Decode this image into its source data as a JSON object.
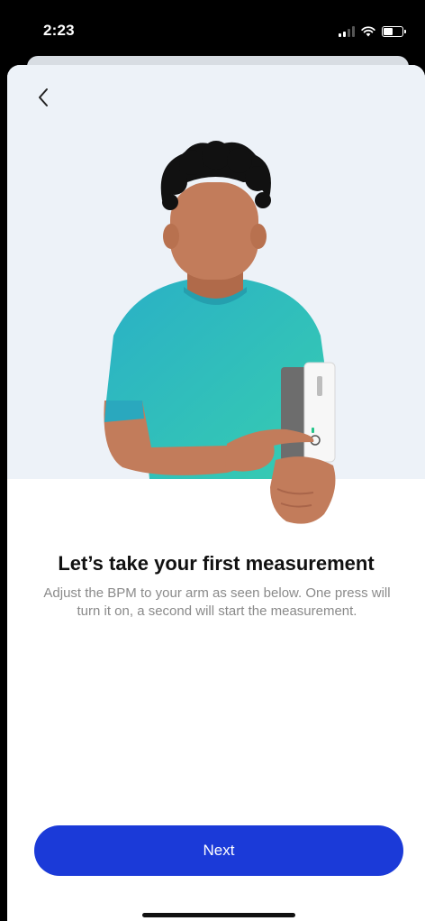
{
  "status_bar": {
    "time": "2:23",
    "icons": [
      "signal-icon",
      "wifi-icon",
      "battery-icon"
    ]
  },
  "header": {
    "back_icon": "chevron-left-icon"
  },
  "illustration": {
    "description_icon": "person-with-blood-pressure-monitor-illustration",
    "colors": {
      "background": "#edf2f8",
      "skin": "#c07a5a",
      "hair": "#111111",
      "shirt": "#2bb3c0",
      "device": "#ffffff"
    }
  },
  "content": {
    "headline": "Let’s take your first measurement",
    "description": "Adjust the BPM to your arm as seen below. One press will turn it on, a second will start the measurement."
  },
  "footer": {
    "next_label": "Next",
    "accent_color": "#1b3ad8"
  }
}
